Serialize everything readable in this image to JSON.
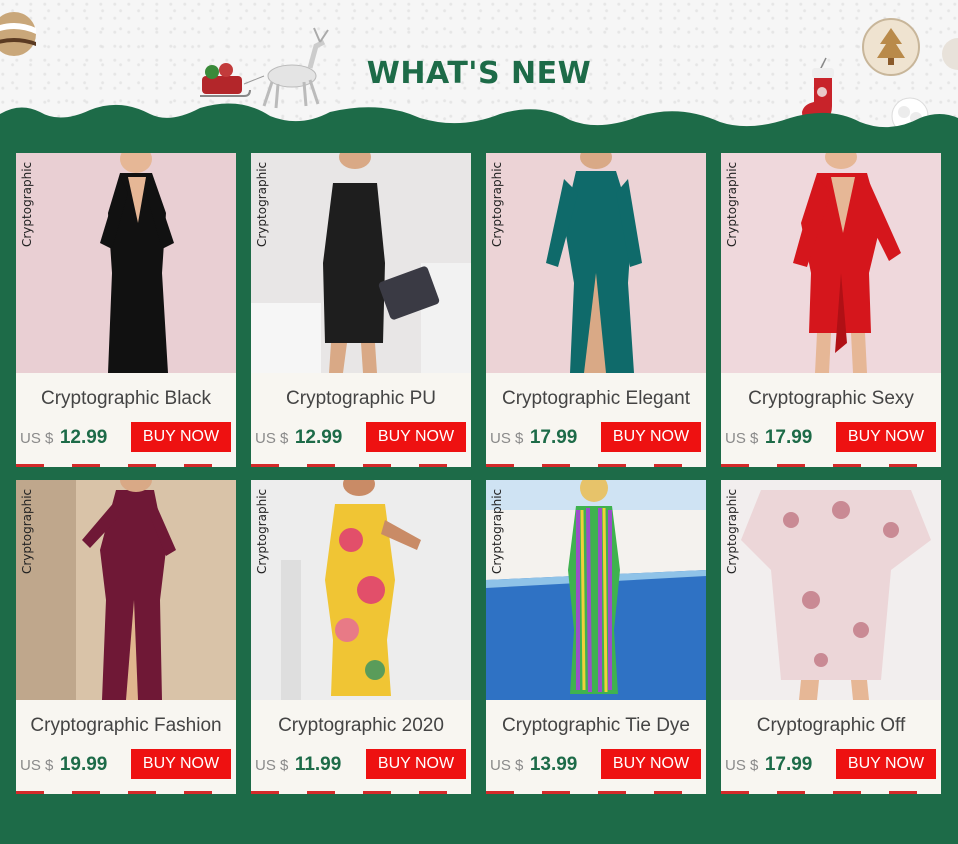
{
  "header": {
    "title": "WHAT'S NEW",
    "colors": {
      "green": "#1d6b48",
      "red": "#ee1111"
    },
    "decorations": [
      "ornament-icon",
      "reindeer-sleigh-icon",
      "christmas-stocking-icon",
      "tree-cookie-icon",
      "pinecone-icon"
    ]
  },
  "products": [
    {
      "brand": "Cryptographic",
      "name": "Cryptographic Black",
      "currency": "US $",
      "price": "12.99",
      "button": "BUY NOW",
      "dress_color": "#111111",
      "bg": "#e9cfd3"
    },
    {
      "brand": "Cryptographic",
      "name": "Cryptographic PU",
      "currency": "US $",
      "price": "12.99",
      "button": "BUY NOW",
      "dress_color": "#1e1e1e",
      "bg": "#e8e6e6"
    },
    {
      "brand": "Cryptographic",
      "name": "Cryptographic Elegant",
      "currency": "US $",
      "price": "17.99",
      "button": "BUY NOW",
      "dress_color": "#0f6a6a",
      "bg": "#ecd3d6"
    },
    {
      "brand": "Cryptographic",
      "name": "Cryptographic Sexy",
      "currency": "US $",
      "price": "17.99",
      "button": "BUY NOW",
      "dress_color": "#d5161c",
      "bg": "#efd8dc"
    },
    {
      "brand": "Cryptographic",
      "name": "Cryptographic Fashion",
      "currency": "US $",
      "price": "19.99",
      "button": "BUY NOW",
      "dress_color": "#6f1836",
      "bg": "#d9c3a8"
    },
    {
      "brand": "Cryptographic",
      "name": "Cryptographic 2020",
      "currency": "US $",
      "price": "11.99",
      "button": "BUY NOW",
      "dress_color": "#f0c534",
      "bg": "#ededed"
    },
    {
      "brand": "Cryptographic",
      "name": "Cryptographic Tie Dye",
      "currency": "US $",
      "price": "13.99",
      "button": "BUY NOW",
      "dress_color": "#3fb24f",
      "bg": "#2f72c4"
    },
    {
      "brand": "Cryptographic",
      "name": "Cryptographic Off",
      "currency": "US $",
      "price": "17.99",
      "button": "BUY NOW",
      "dress_color": "#ecd6d8",
      "bg": "#f2eeee"
    }
  ]
}
